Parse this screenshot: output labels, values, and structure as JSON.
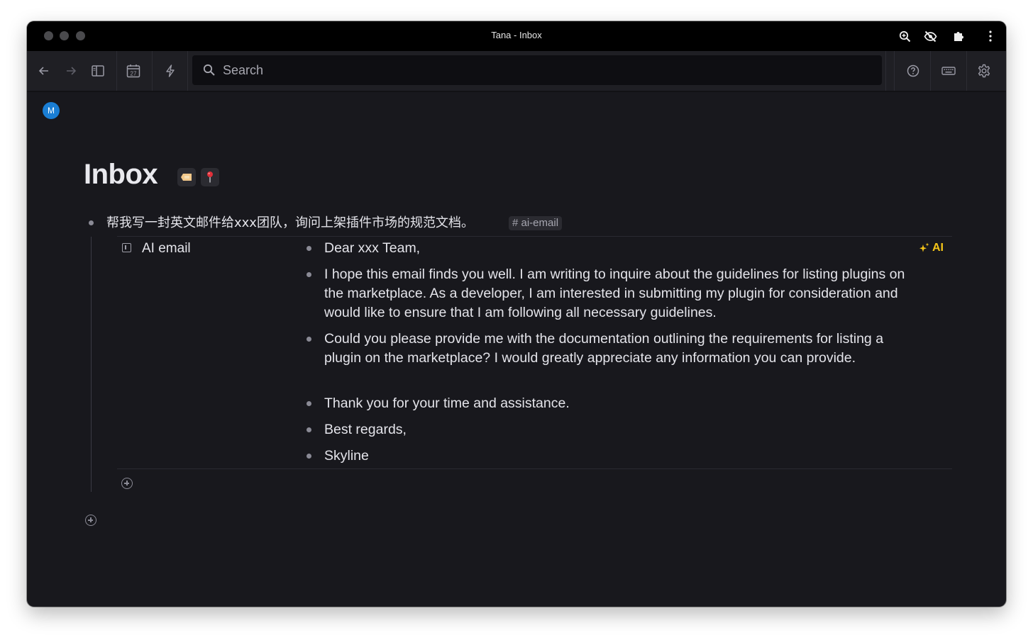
{
  "window": {
    "title": "Tana - Inbox"
  },
  "titlebar_icons": [
    "zoom-in-icon",
    "eye-off-icon",
    "puzzle-icon",
    "more-vertical-icon"
  ],
  "toolbar": {
    "back_icon": "arrow-left-icon",
    "forward_icon": "arrow-right-icon",
    "sidebar_icon": "sidebar-toggle-icon",
    "calendar_day": "27",
    "quick_add_icon": "lightning-icon",
    "search_placeholder": "Search",
    "help_icon": "help-circle-icon",
    "keyboard_icon": "keyboard-icon",
    "settings_icon": "gear-icon"
  },
  "user": {
    "avatar_initial": "M",
    "avatar_color": "#1a7ed4"
  },
  "page": {
    "title": "Inbox",
    "badges": [
      "tag-icon",
      "pin-icon"
    ]
  },
  "node": {
    "text": "帮我写一封英文邮件给xxx团队，询问上架插件市场的规范文档。",
    "tag": "# ai-email",
    "field": {
      "name": "AI email",
      "ai_label": "AI",
      "ai_color": "#f5c518",
      "values": [
        "Dear xxx Team,",
        "I hope this email finds you well. I am writing to inquire about the guidelines for listing plugins on the marketplace. As a developer, I am interested in submitting my plugin for consideration and would like to ensure that I am following all necessary guidelines.",
        "Could you please provide me with the documentation outlining the requirements for listing a plugin on the marketplace? I would greatly appreciate any information you can provide.",
        "Thank you for your time and assistance.",
        "Best regards,",
        "Skyline"
      ]
    }
  }
}
